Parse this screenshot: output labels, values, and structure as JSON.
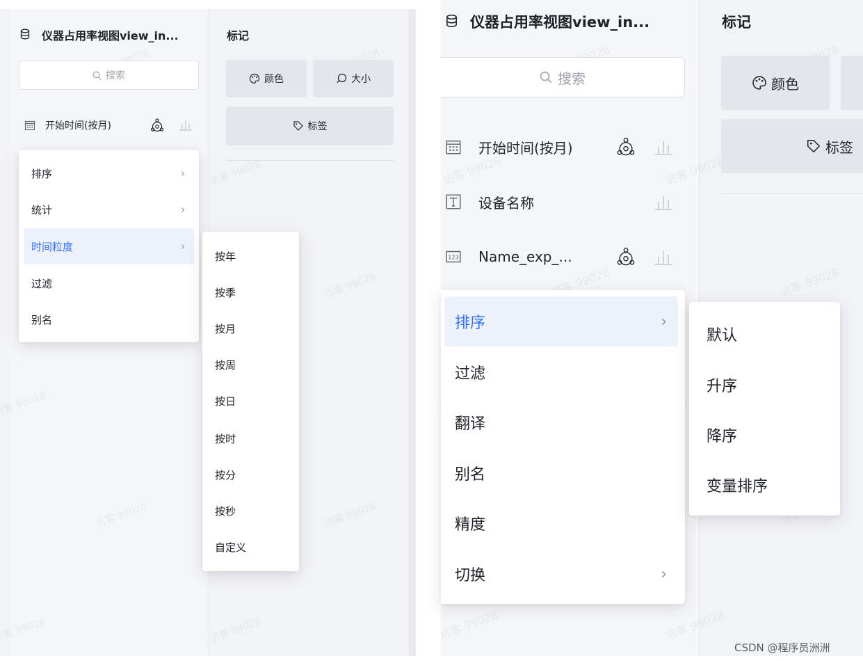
{
  "left": {
    "dataset_title": "仪器占用率视图view_in...",
    "search_placeholder": "搜索",
    "marks_title": "标记",
    "chips": {
      "color": "颜色",
      "size": "大小",
      "label": "标签"
    },
    "field": {
      "name": "开始时间(按月)"
    },
    "menu": [
      "排序",
      "统计",
      "时间粒度",
      "过滤",
      "别名"
    ],
    "active_index": 2,
    "submenu": [
      "按年",
      "按季",
      "按月",
      "按周",
      "按日",
      "按时",
      "按分",
      "按秒",
      "自定义"
    ]
  },
  "right": {
    "dataset_title": "仪器占用率视图view_in...",
    "search_placeholder": "搜索",
    "marks_title": "标记",
    "chips": {
      "color": "颜色",
      "label": "标签"
    },
    "fields": [
      {
        "name": "开始时间(按月)",
        "icon": "calendar-icon"
      },
      {
        "name": "设备名称",
        "icon": "text-type-icon"
      },
      {
        "name": "Name_exp_...",
        "icon": "number-type-icon"
      }
    ],
    "menu": [
      "排序",
      "过滤",
      "翻译",
      "别名",
      "精度",
      "切换"
    ],
    "active_index": 0,
    "submenu": [
      "默认",
      "升序",
      "降序",
      "变量排序"
    ]
  },
  "watermark": "访客 99028",
  "credit": "CSDN @程序员洲洲",
  "colors": {
    "accent": "#3370ff",
    "panel": "#f2f3f6",
    "chip": "#e4e6ec"
  }
}
